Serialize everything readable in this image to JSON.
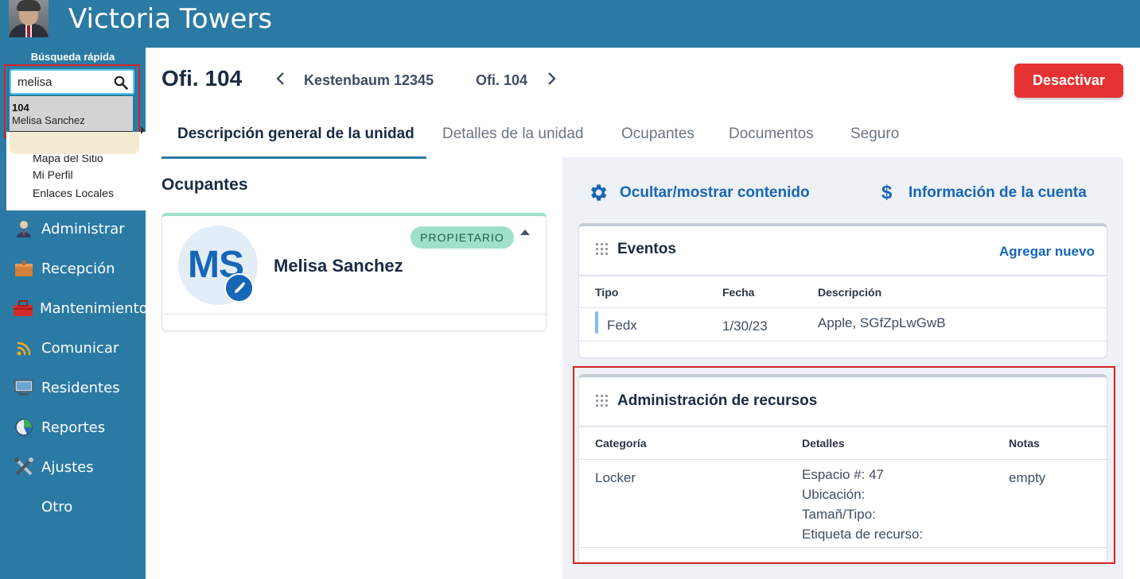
{
  "app": {
    "title": "Victoria Towers"
  },
  "sidebar": {
    "quick_search_label": "Búsqueda rápida",
    "search_value": "melisa",
    "search_result": {
      "unit": "104",
      "name": "Melisa Sanchez"
    },
    "menu_links": [
      "Mapa del Sitio",
      "Mi Perfil",
      "Enlaces Locales"
    ],
    "nav": [
      {
        "label": "Administrar",
        "icon": "admin-person-icon"
      },
      {
        "label": "Recepción",
        "icon": "reception-box-icon"
      },
      {
        "label": "Mantenimiento",
        "icon": "toolbox-icon"
      },
      {
        "label": "Comunicar",
        "icon": "wifi-signal-icon"
      },
      {
        "label": "Residentes",
        "icon": "monitor-icon"
      },
      {
        "label": "Reportes",
        "icon": "pie-chart-icon"
      },
      {
        "label": "Ajustes",
        "icon": "tools-icon"
      },
      {
        "label": "Otro",
        "icon": ""
      }
    ]
  },
  "header": {
    "unit_title": "Ofi. 104",
    "crumb_building": "Kestenbaum 12345",
    "crumb_unit": "Ofi. 104",
    "deactivate_label": "Desactivar"
  },
  "tabs": [
    {
      "label": "Descripción general de la unidad",
      "active": true
    },
    {
      "label": "Detalles de la unidad",
      "active": false
    },
    {
      "label": "Ocupantes",
      "active": false
    },
    {
      "label": "Documentos",
      "active": false
    },
    {
      "label": "Seguro",
      "active": false
    }
  ],
  "occupants": {
    "title": "Ocupantes",
    "initials": "MS",
    "name": "Melisa Sanchez",
    "badge": "PROPIETARIO"
  },
  "actions": {
    "toggle_content": "Ocultar/mostrar contenido",
    "account_info": "Información de la cuenta"
  },
  "events": {
    "title": "Eventos",
    "add_new": "Agregar nuevo",
    "columns": [
      "Tipo",
      "Fecha",
      "Descripción"
    ],
    "rows": [
      {
        "type": "Fedx",
        "date": "1/30/23",
        "description": "Apple, SGfZpLwGwB"
      }
    ]
  },
  "resources": {
    "title": "Administración de recursos",
    "columns": [
      "Categoría",
      "Detalles",
      "Notas"
    ],
    "rows": [
      {
        "category": "Locker",
        "details": [
          "Espacio #: 47",
          "Ubicación:",
          "Tamañ/Tipo:",
          "Etiqueta de recurso:"
        ],
        "notes": "empty"
      }
    ]
  },
  "colors": {
    "brand": "#2b7aa4",
    "danger": "#e63232",
    "link": "#1666b8",
    "owner_badge": "#9fe0c9"
  }
}
